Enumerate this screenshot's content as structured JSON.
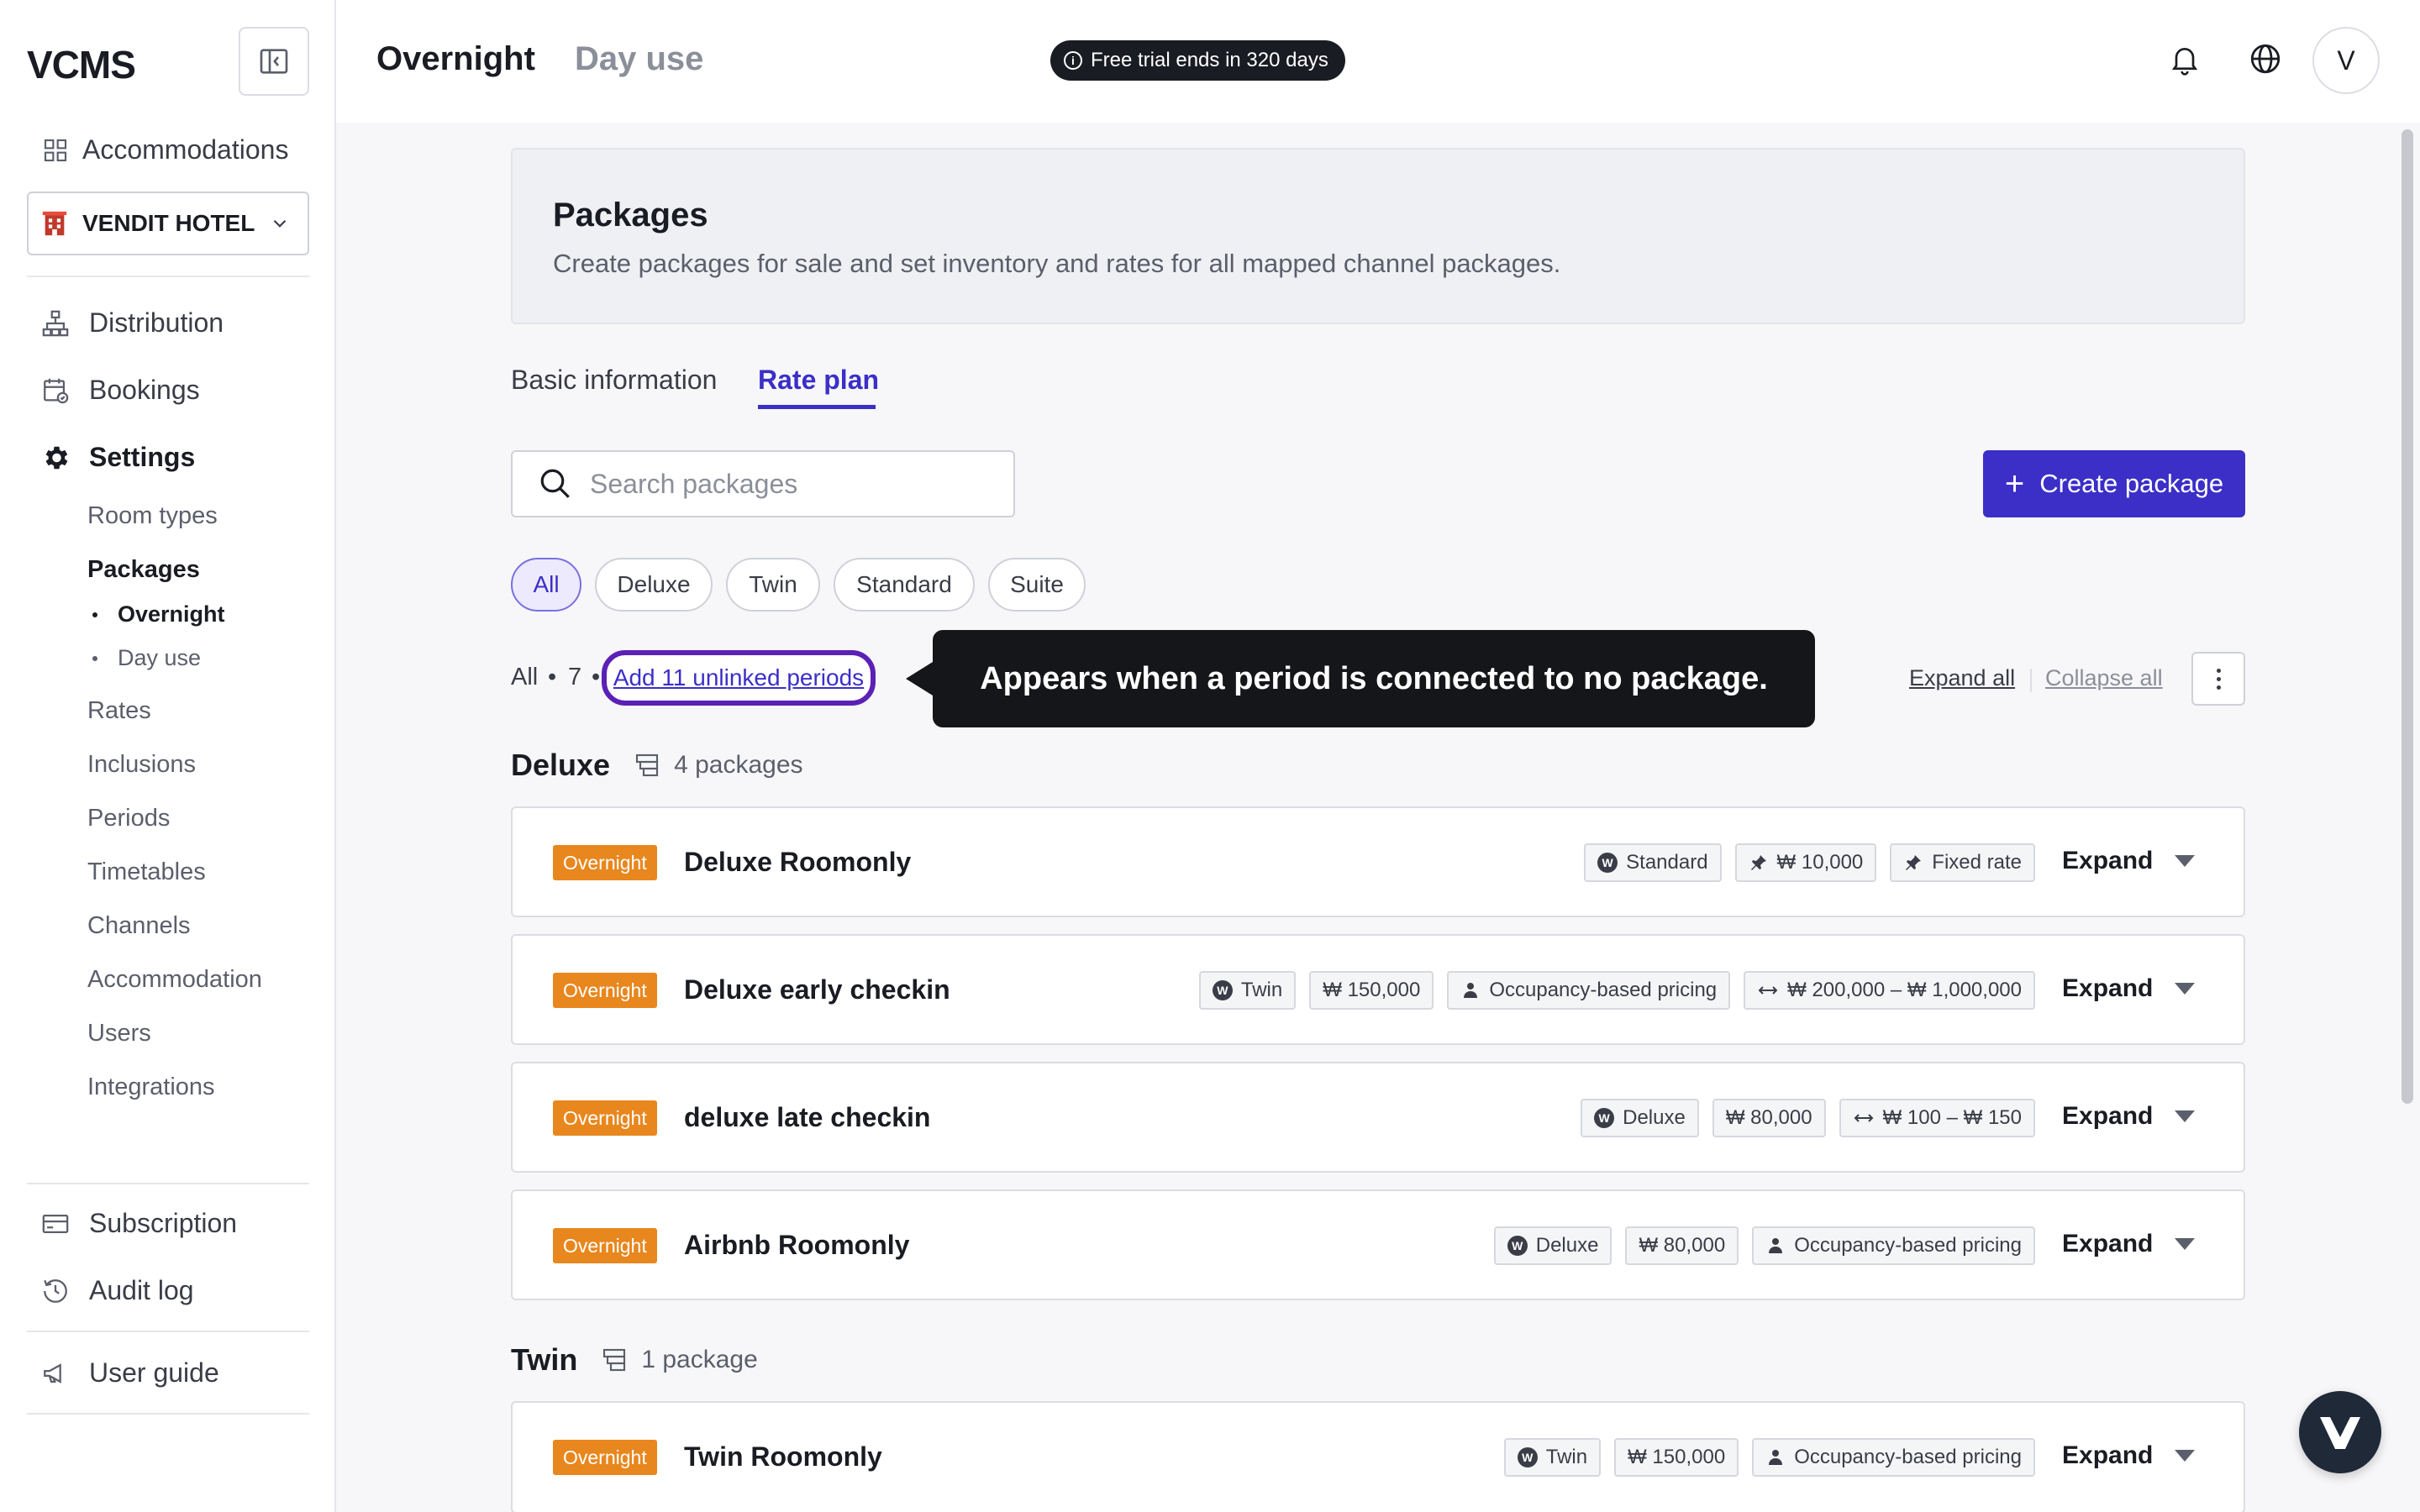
{
  "sidebar": {
    "logo": "VCMS",
    "accommodations_label": "Accommodations",
    "hotel_name": "VENDIT HOTEL",
    "nav": {
      "distribution": "Distribution",
      "bookings": "Bookings",
      "settings": "Settings"
    },
    "settings_items": {
      "room_types": "Room types",
      "packages": "Packages",
      "overnight": "Overnight",
      "day_use": "Day use",
      "rates": "Rates",
      "inclusions": "Inclusions",
      "periods": "Periods",
      "timetables": "Timetables",
      "channels": "Channels",
      "accommodation": "Accommodation",
      "users": "Users",
      "integrations": "Integrations"
    },
    "subscription": "Subscription",
    "audit_log": "Audit log",
    "user_guide": "User guide"
  },
  "header": {
    "tab_overnight": "Overnight",
    "tab_day_use": "Day use",
    "trial_text": "Free trial ends in 320 days",
    "avatar_letter": "V"
  },
  "hero": {
    "title": "Packages",
    "description": "Create packages for sale and set inventory and rates for all mapped channel packages."
  },
  "content_tabs": {
    "basic_information": "Basic information",
    "rate_plan": "Rate plan"
  },
  "search": {
    "placeholder": "Search packages"
  },
  "create_button": "Create package",
  "filters": [
    "All",
    "Deluxe",
    "Twin",
    "Standard",
    "Suite"
  ],
  "summary": {
    "all_label": "All",
    "separator": "•",
    "count": "7",
    "unlinked_link": "Add 11 unlinked periods",
    "tooltip": "Appears when a period is connected to no package.",
    "expand_all": "Expand all",
    "collapse_all": "Collapse all"
  },
  "groups": [
    {
      "name": "Deluxe",
      "count_label": "4 packages",
      "cards": [
        {
          "badge": "Overnight",
          "title": "Deluxe Roomonly",
          "tags": [
            "Standard",
            "₩ 10,000",
            "Fixed rate"
          ],
          "expand": "Expand"
        },
        {
          "badge": "Overnight",
          "title": "Deluxe early checkin",
          "tags": [
            "Twin",
            "₩ 150,000",
            "Occupancy-based pricing",
            "₩ 200,000 – ₩ 1,000,000"
          ],
          "expand": "Expand"
        },
        {
          "badge": "Overnight",
          "title": "deluxe late checkin",
          "tags": [
            "Deluxe",
            "₩ 80,000",
            "₩ 100 – ₩ 150"
          ],
          "expand": "Expand"
        },
        {
          "badge": "Overnight",
          "title": "Airbnb Roomonly",
          "tags": [
            "Deluxe",
            "₩ 80,000",
            "Occupancy-based pricing"
          ],
          "expand": "Expand"
        }
      ]
    },
    {
      "name": "Twin",
      "count_label": "1 package",
      "cards": [
        {
          "badge": "Overnight",
          "title": "Twin Roomonly",
          "tags": [
            "Twin",
            "₩ 150,000",
            "Occupancy-based pricing"
          ],
          "expand": "Expand"
        }
      ]
    }
  ],
  "colors": {
    "accent": "#3b2fc7",
    "badge_orange": "#e8871e",
    "tooltip_bg": "#15161a"
  }
}
